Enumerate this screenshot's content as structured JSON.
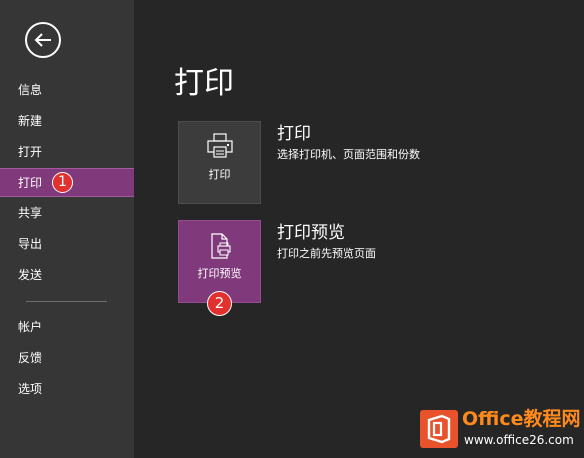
{
  "sidebar": {
    "back_icon": "back-arrow-icon",
    "items": [
      {
        "label": "信息"
      },
      {
        "label": "新建"
      },
      {
        "label": "打开"
      },
      {
        "label": "打印",
        "selected": true
      },
      {
        "label": "共享"
      },
      {
        "label": "导出"
      },
      {
        "label": "发送"
      },
      {
        "label": "帐户"
      },
      {
        "label": "反馈"
      },
      {
        "label": "选项"
      }
    ],
    "selected_color": "#80397b"
  },
  "main": {
    "title": "打印",
    "options": [
      {
        "tile_label": "打印",
        "title": "打印",
        "description": "选择打印机、页面范围和份数",
        "icon": "printer-icon"
      },
      {
        "tile_label": "打印预览",
        "title": "打印预览",
        "description": "打印之前先预览页面",
        "icon": "print-preview-icon"
      }
    ]
  },
  "callouts": [
    "1",
    "2"
  ],
  "watermark": {
    "brand": "Office教程网",
    "url": "www.office26.com"
  },
  "colors": {
    "sidebar_bg": "#363636",
    "main_bg": "#262626",
    "accent_purple": "#80397b",
    "callout_red": "#e2302f",
    "watermark_orange": "#ff8a1c"
  }
}
